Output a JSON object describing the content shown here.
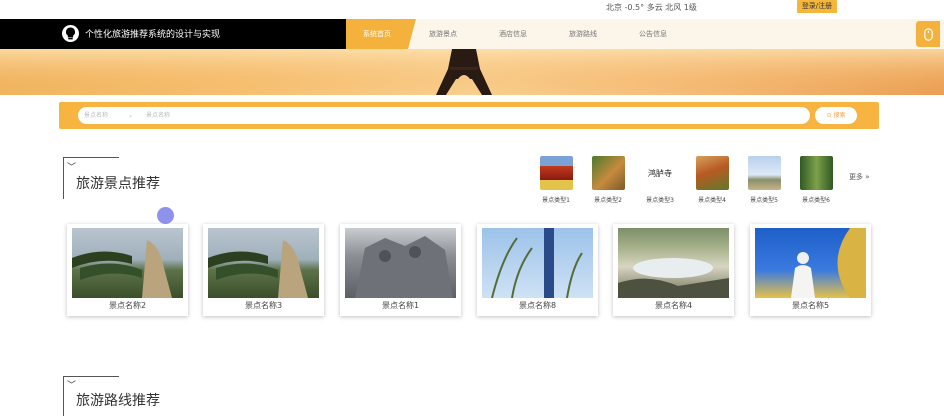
{
  "header": {
    "weather": "北京 -0.5° 多云 北风 1级",
    "login_label": "登录/注册"
  },
  "nav": {
    "title": "个性化旅游推荐系统的设计与实现",
    "items": [
      {
        "label": "系统首页",
        "active": true
      },
      {
        "label": "旅游景点",
        "active": false
      },
      {
        "label": "酒店信息",
        "active": false
      },
      {
        "label": "旅游路线",
        "active": false
      },
      {
        "label": "公告信息",
        "active": false
      }
    ],
    "accent": "#f4b13c"
  },
  "search": {
    "select_value": "景点名称",
    "placeholder": "景点名称",
    "button_label": "搜索"
  },
  "sections": {
    "spots_title": "旅游景点推荐",
    "routes_title": "旅游路线推荐"
  },
  "spot_types": [
    {
      "label": "景点类型1"
    },
    {
      "label": "景点类型2"
    },
    {
      "label": "景点类型3",
      "image_text": "鸿胪寺"
    },
    {
      "label": "景点类型4"
    },
    {
      "label": "景点类型5"
    },
    {
      "label": "景点类型6"
    }
  ],
  "more_label": "更多 »",
  "spots": [
    {
      "name": "景点名称2"
    },
    {
      "name": "景点名称3"
    },
    {
      "name": "景点名称1"
    },
    {
      "name": "景点名称8"
    },
    {
      "name": "景点名称4"
    },
    {
      "name": "景点名称5"
    }
  ]
}
